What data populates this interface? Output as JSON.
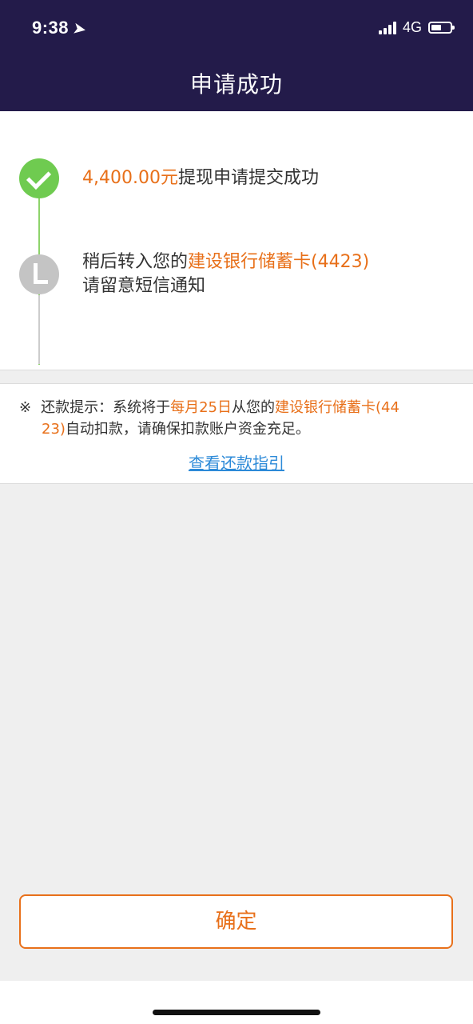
{
  "status_bar": {
    "time": "9:38",
    "network": "4G"
  },
  "header": {
    "title": "申请成功"
  },
  "steps": [
    {
      "status": "done",
      "amount": "4,400.00元",
      "text": "提现申请提交成功"
    },
    {
      "status": "pending",
      "prefix": "稍后转入您的",
      "bank": "建设银行储蓄卡(4423)",
      "line2": "请留意短信通知"
    }
  ],
  "notice": {
    "mark": "※",
    "label": "还款提示：系统将于",
    "date": "每月25日",
    "mid": "从您的",
    "bank_part1": "建设银行储蓄卡(44",
    "bank_part2": "23)",
    "tail": "自动扣款，请确保扣款账户资金充足。",
    "link": "查看还款指引"
  },
  "actions": {
    "confirm_label": "确定"
  },
  "colors": {
    "header_bg": "#231b4a",
    "accent": "#e8701a",
    "success": "#6fcb50",
    "link": "#2c8ad8"
  }
}
